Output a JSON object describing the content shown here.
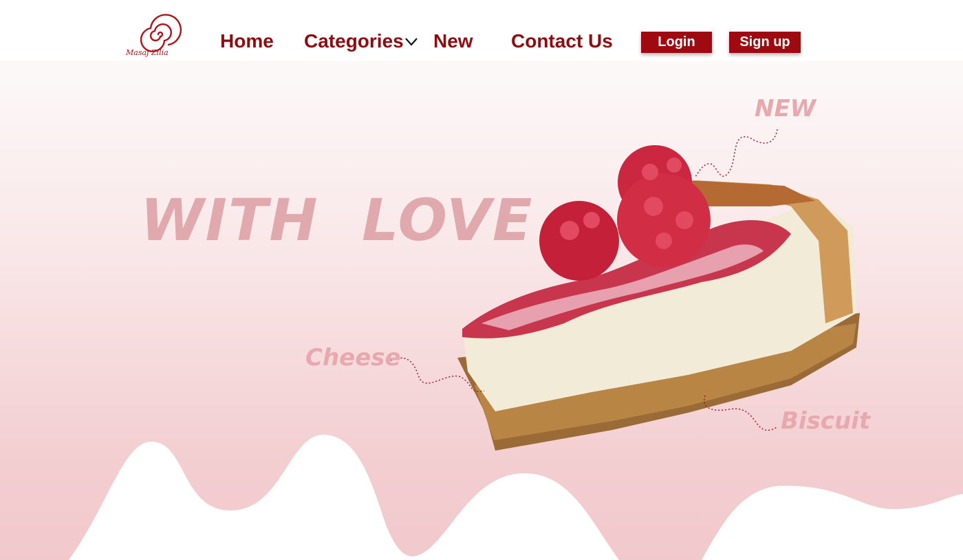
{
  "nav": {
    "logo_text": "Masaj Zilia",
    "items": [
      {
        "label": "Home"
      },
      {
        "label": "Categories"
      },
      {
        "label": "New"
      },
      {
        "label": "Contact Us"
      }
    ],
    "login_label": "Login",
    "signup_label": "Sign up"
  },
  "hero": {
    "headline": "WITH  LOVE",
    "tags": {
      "new": "NEW",
      "cheese": "Cheese",
      "biscuit": "Biscuit"
    }
  },
  "colors": {
    "brand": "#9e0a10",
    "accent_text": "#e0a9ad",
    "hero_pink": "#f1c9cc"
  },
  "icons": {
    "logo": "spiral-logo-icon",
    "dropdown": "chevron-down-icon",
    "hero_image": "raspberry-cheesecake-slice"
  }
}
